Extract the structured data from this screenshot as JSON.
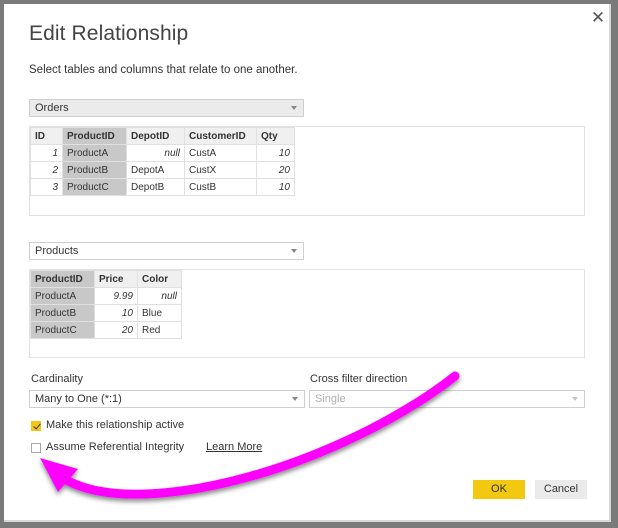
{
  "dialog": {
    "title": "Edit Relationship",
    "subtitle": "Select tables and columns that relate to one another.",
    "close_icon": "close-icon"
  },
  "table1": {
    "selected": "Orders",
    "columns": [
      "ID",
      "ProductID",
      "DepotID",
      "CustomerID",
      "Qty"
    ],
    "selected_column": "ProductID",
    "rows": [
      [
        "1",
        "ProductA",
        "null",
        "CustA",
        "10"
      ],
      [
        "2",
        "ProductB",
        "DepotA",
        "CustX",
        "20"
      ],
      [
        "3",
        "ProductC",
        "DepotB",
        "CustB",
        "10"
      ]
    ]
  },
  "table2": {
    "selected": "Products",
    "columns": [
      "ProductID",
      "Price",
      "Color"
    ],
    "selected_column": "ProductID",
    "rows": [
      [
        "ProductA",
        "9.99",
        "null"
      ],
      [
        "ProductB",
        "10",
        "Blue"
      ],
      [
        "ProductC",
        "20",
        "Red"
      ]
    ]
  },
  "cardinality": {
    "label": "Cardinality",
    "value": "Many to One (*:1)"
  },
  "cross_filter": {
    "label": "Cross filter direction",
    "value": "Single",
    "disabled": true
  },
  "options": {
    "active": {
      "label": "Make this relationship active",
      "checked": true
    },
    "referential": {
      "label": "Assume Referential Integrity",
      "checked": false
    },
    "learn_more": "Learn More"
  },
  "buttons": {
    "ok": "OK",
    "cancel": "Cancel"
  },
  "annotation": {
    "type": "curved-arrow",
    "color": "#ff00ff",
    "points_to": "Assume Referential Integrity checkbox"
  }
}
